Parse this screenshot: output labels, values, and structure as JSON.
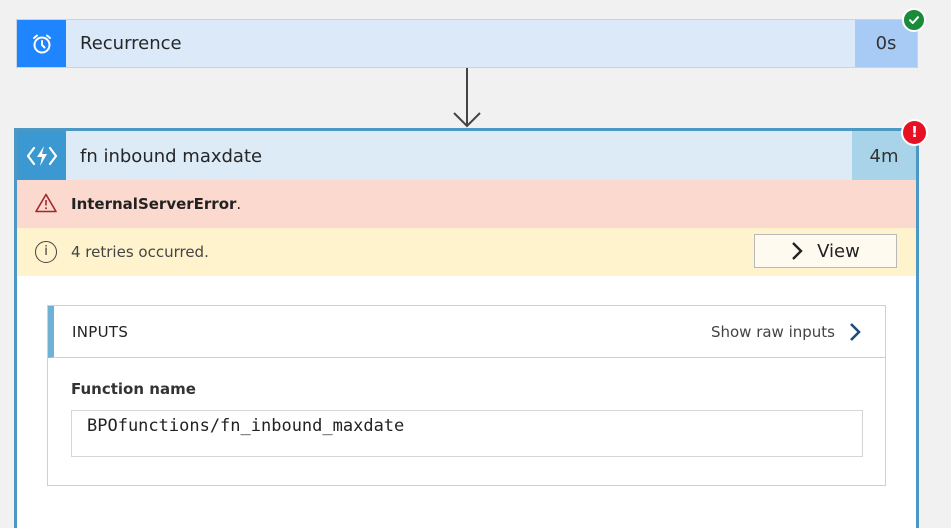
{
  "recurrence": {
    "title": "Recurrence",
    "duration": "0s",
    "status": "succeeded",
    "icon": "alarm-clock-icon",
    "colors": {
      "icon_bg": "#1f85ff",
      "header_bg": "#dce9f9",
      "duration_bg": "#a8cbf5",
      "status": "#1b8a3a"
    }
  },
  "function_action": {
    "title": "fn inbound maxdate",
    "duration": "4m",
    "status": "failed",
    "icon": "azure-function-icon",
    "status_glyph": "!",
    "colors": {
      "icon_bg": "#3b98d0",
      "header_bg": "#dcebf6",
      "duration_bg": "#a9d3e8",
      "border": "#4b98c4",
      "status": "#e81123"
    },
    "error": {
      "code": "InternalServerError",
      "suffix": ".",
      "icon": "warning-triangle-icon"
    },
    "info": {
      "text": "4 retries occurred.",
      "icon": "info-icon",
      "icon_glyph": "i",
      "view_button_label": "View"
    },
    "inputs": {
      "header": "INPUTS",
      "show_raw_label": "Show raw inputs",
      "field_label": "Function name",
      "field_value": "BPOfunctions/fn_inbound_maxdate"
    }
  }
}
